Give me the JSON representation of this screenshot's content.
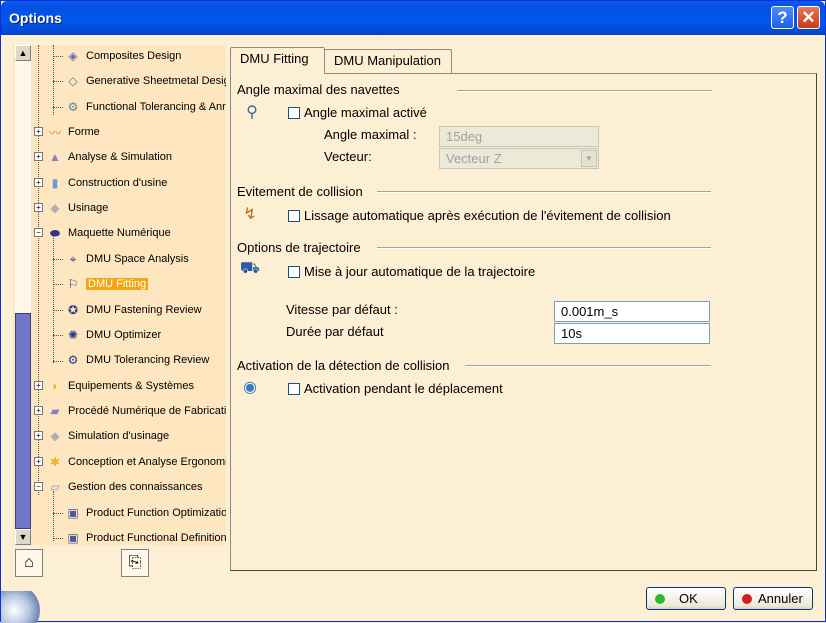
{
  "window": {
    "title": "Options",
    "help_glyph": "?",
    "close_glyph": "✕"
  },
  "colors": {
    "titlebar": "#0054e3",
    "panel_bg": "#fdefd3",
    "tree_bg": "#fde6c0",
    "selection": "#f3a512",
    "ok_dot": "#2eb82e",
    "cancel_dot": "#d02020"
  },
  "tree": {
    "items": [
      {
        "label": "Composites Design",
        "icon": "composites-icon"
      },
      {
        "label": "Generative Sheetmetal Desig",
        "icon": "sheetmetal-icon"
      },
      {
        "label": "Functional Tolerancing & Ann",
        "icon": "tolerancing-icon"
      },
      {
        "label": "Forme",
        "icon": "shape-icon"
      },
      {
        "label": "Analyse & Simulation",
        "icon": "analysis-icon"
      },
      {
        "label": "Construction d'usine",
        "icon": "plant-icon"
      },
      {
        "label": "Usinage",
        "icon": "machining-icon"
      },
      {
        "label": "Maquette Numérique",
        "icon": "digital-mockup-icon"
      },
      {
        "label": "DMU Space Analysis",
        "icon": "dmu-space-icon"
      },
      {
        "label": "DMU Fitting",
        "icon": "dmu-fitting-icon"
      },
      {
        "label": "DMU Fastening Review",
        "icon": "dmu-fastening-icon"
      },
      {
        "label": "DMU Optimizer",
        "icon": "dmu-optimizer-icon"
      },
      {
        "label": "DMU Tolerancing Review",
        "icon": "dmu-tolerancing-icon"
      },
      {
        "label": "Equipements & Systèmes",
        "icon": "equipment-icon"
      },
      {
        "label": "Procédé Numérique de Fabricatic",
        "icon": "manufacturing-icon"
      },
      {
        "label": "Simulation d'usinage",
        "icon": "machining-sim-icon"
      },
      {
        "label": "Conception et Analyse Ergonomi",
        "icon": "ergonomics-icon"
      },
      {
        "label": "Gestion des connaissances",
        "icon": "knowledge-icon"
      },
      {
        "label": "Product Function Optimizatior",
        "icon": "product-function-icon"
      },
      {
        "label": "Product Functional Definition",
        "icon": "functional-definition-icon"
      }
    ],
    "selected": "DMU Fitting"
  },
  "tabs": [
    {
      "label": "DMU Fitting",
      "active": true
    },
    {
      "label": "DMU Manipulation",
      "active": false
    }
  ],
  "sections": {
    "shuttle": {
      "title": "Angle maximal des navettes",
      "checkbox_label": "Angle maximal activé",
      "checked": false,
      "angle_label": "Angle maximal :",
      "angle_value": "15deg",
      "vector_label": "Vecteur:",
      "vector_value": "Vecteur Z"
    },
    "collision": {
      "title": "Evitement de collision",
      "checkbox_label": "Lissage automatique après exécution de l'évitement de collision",
      "checked": false
    },
    "trajectory": {
      "title": "Options de trajectoire",
      "checkbox_label": "Mise à jour automatique de la trajectoire",
      "checked": false,
      "speed_label": "Vitesse par défaut :",
      "speed_value": "0.001m_s",
      "duration_label": "Durée par défaut",
      "duration_value": "10s"
    },
    "detection": {
      "title": "Activation de la détection de collision",
      "checkbox_label": "Activation pendant le déplacement",
      "checked": false
    }
  },
  "buttons": {
    "ok": "OK",
    "cancel": "Annuler"
  }
}
